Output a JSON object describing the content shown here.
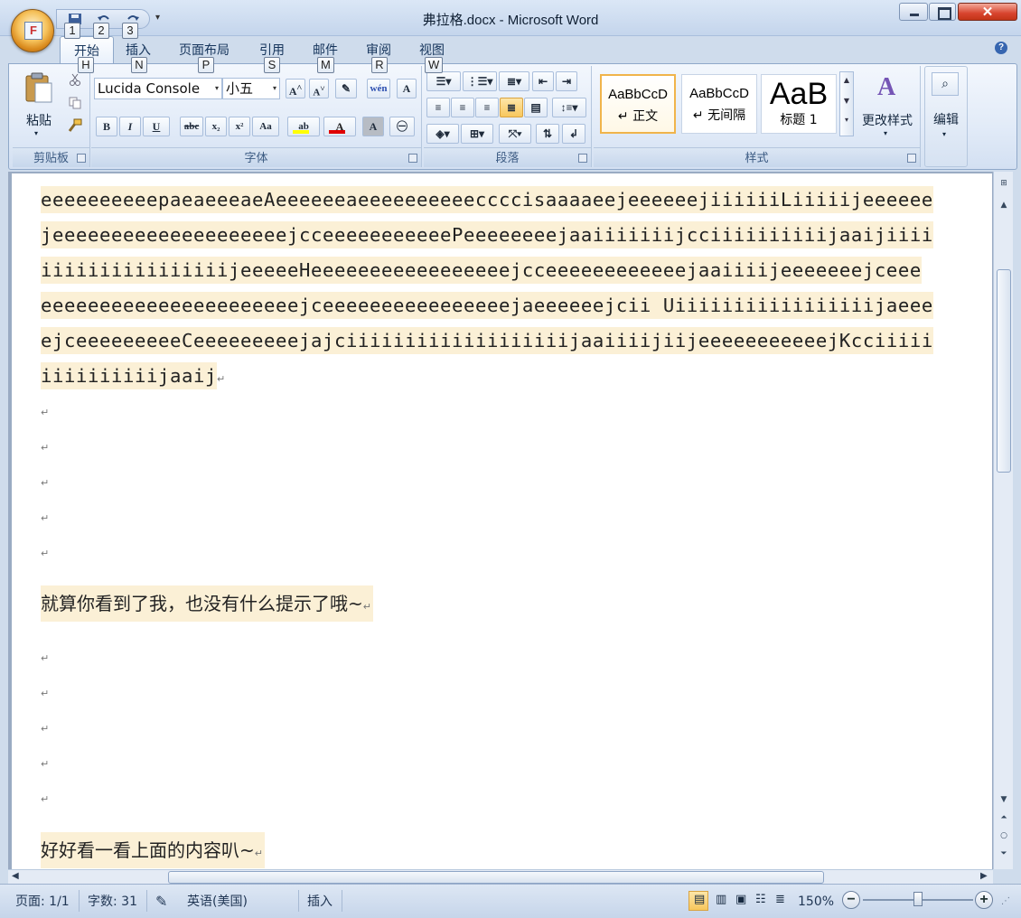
{
  "window": {
    "title": "弗拉格.docx - Microsoft Word",
    "office_button_letter": "F"
  },
  "quick_access": {
    "keytips": [
      "1",
      "2",
      "3"
    ]
  },
  "ribbon_tabs": [
    {
      "label": "开始",
      "keytip": "H"
    },
    {
      "label": "插入",
      "keytip": "N"
    },
    {
      "label": "页面布局",
      "keytip": "P"
    },
    {
      "label": "引用",
      "keytip": "S"
    },
    {
      "label": "邮件",
      "keytip": "M"
    },
    {
      "label": "审阅",
      "keytip": "R"
    },
    {
      "label": "视图",
      "keytip": "W"
    }
  ],
  "clipboard": {
    "paste_label": "粘贴",
    "group_label": "剪贴板"
  },
  "font": {
    "font_name": "Lucida Console",
    "font_size": "小五",
    "group_label": "字体",
    "bold": "B",
    "italic": "I",
    "underline": "U",
    "strike": "abc",
    "subscript": "x₂",
    "superscript": "x²",
    "change_case": "Aa",
    "grow": "A",
    "shrink": "A",
    "phonetic": "wén",
    "charborder": "A",
    "shade": "A",
    "highlight_color": "#ffff00",
    "font_color": "#e00000"
  },
  "paragraph": {
    "group_label": "段落"
  },
  "styles": {
    "group_label": "样式",
    "items": [
      {
        "sample": "AaBbCcD",
        "name": "↵ 正文"
      },
      {
        "sample": "AaBbCcD",
        "name": "↵ 无间隔"
      },
      {
        "sample": "AaB",
        "name": "标题 1"
      }
    ],
    "change_styles_label": "更改样式"
  },
  "editing": {
    "label": "编辑"
  },
  "document": {
    "code_lines": [
      "eeeeeeeeeepaeaeeeaeAeeeeeeaeeeeeeeeeeccccisaaaaeejeeeeeejiiiiiiLiiiiijeeeeee",
      "jeeeeeeeeeeeeeeeeeeeejcceeeeeeeeeeePeeeeeeeejaaiiiiiiijcciiiiiiiiiijaaijiiii",
      "iiiiiiiiiiiiiiiijeeeeeHeeeeeeeeeeeeeeeeejcceeeeeeeeeeeejaaiiiijeeeeeeejceee",
      "eeeeeeeeeeeeeeeeeeeeeejceeeeeeeeeeeeeeeejaeeeeeejcii Uiiiiiiiiiiiiiiiiijaeee",
      "ejceeeeeeeeeCeeeeeeeeejajciiiiiiiiiiiiiiiiiiijaaiiiijiijeeeeeeeeeeejKcciiiii",
      "iiiiiiiiiijaaij"
    ],
    "chinese_line_1": "就算你看到了我，也没有什么提示了哦~",
    "chinese_line_2": "好好看一看上面的内容叭~",
    "para_mark": "↵"
  },
  "statusbar": {
    "page": "页面: 1/1",
    "words": "字数: 31",
    "language": "英语(美国)",
    "mode": "插入",
    "zoom": "150%",
    "zoom_fraction": 0.5
  }
}
